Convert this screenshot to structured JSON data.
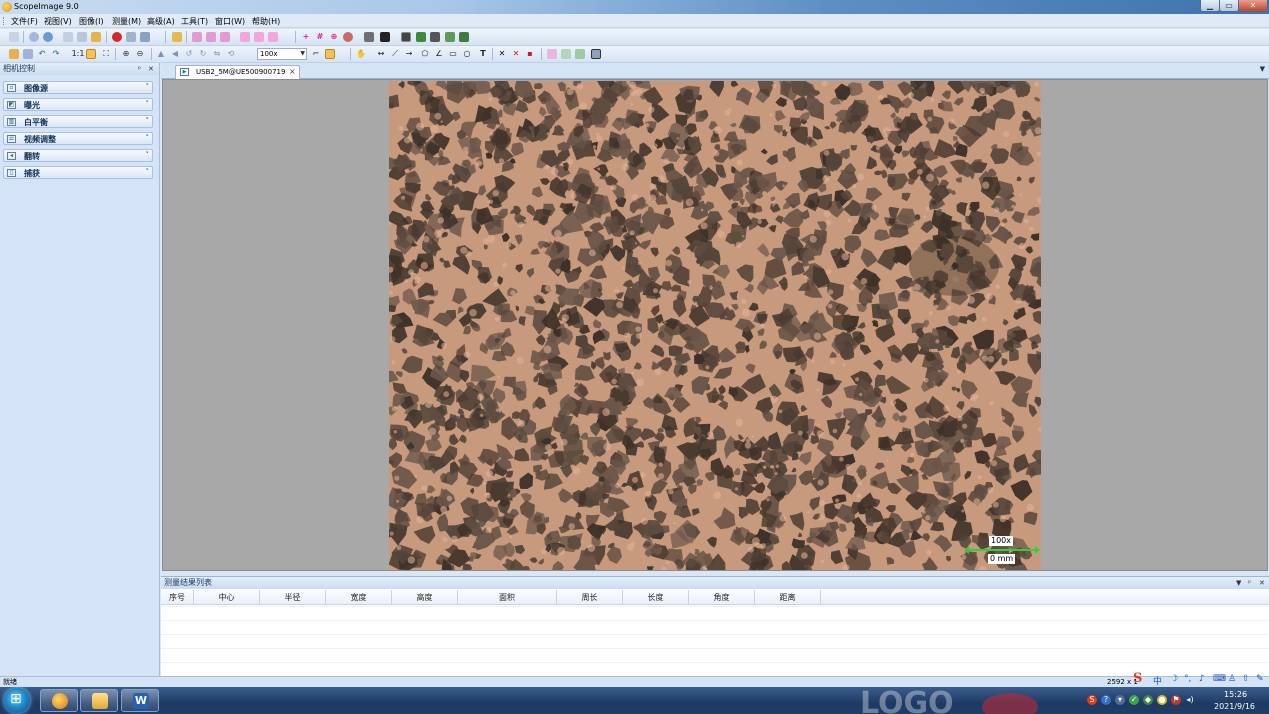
{
  "window": {
    "title": "ScopeImage 9.0",
    "minimize_glyph": "▁",
    "maximize_glyph": "▭",
    "close_glyph": "✕"
  },
  "menubar": {
    "items": [
      "文件(F)",
      "视图(V)",
      "图像(I)",
      "测量(M)",
      "高级(A)",
      "工具(T)",
      "窗口(W)",
      "帮助(H)"
    ]
  },
  "toolbar": {
    "zoom_value": "100x",
    "ratio_label": "1:1",
    "text_tool_label": "T"
  },
  "left_panel": {
    "title": "相机控制",
    "pin_glyph": "ᵖ",
    "close_glyph": "✕",
    "sections": [
      {
        "label": "图像源",
        "icon": "camera-source-icon"
      },
      {
        "label": "曝光",
        "icon": "exposure-icon"
      },
      {
        "label": "白平衡",
        "icon": "white-balance-icon"
      },
      {
        "label": "视频调整",
        "icon": "video-adjust-icon"
      },
      {
        "label": "翻转",
        "icon": "flip-icon"
      },
      {
        "label": "捕获",
        "icon": "capture-icon"
      }
    ]
  },
  "document": {
    "tab_label": "USB2_5M@UE500900719",
    "tab_close": "×"
  },
  "image_overlay": {
    "magnification": "100x",
    "scale_unit": "0 mm"
  },
  "results": {
    "title": "测量结果列表",
    "columns": [
      "序号",
      "中心",
      "半径",
      "宽度",
      "高度",
      "面积",
      "周长",
      "长度",
      "角度",
      "距离"
    ]
  },
  "statusbar": {
    "ready": "就绪",
    "resolution": "2592 x 1"
  },
  "ime": {
    "logo": "S",
    "mode": "中"
  },
  "taskbar": {
    "time": "15:26",
    "date": "2021/9/16"
  },
  "colors": {
    "accent": "#3f72ad",
    "scale_bar": "#2fd13a",
    "specimen_light": "#c89a7d",
    "specimen_dark": "#4a3a30"
  }
}
